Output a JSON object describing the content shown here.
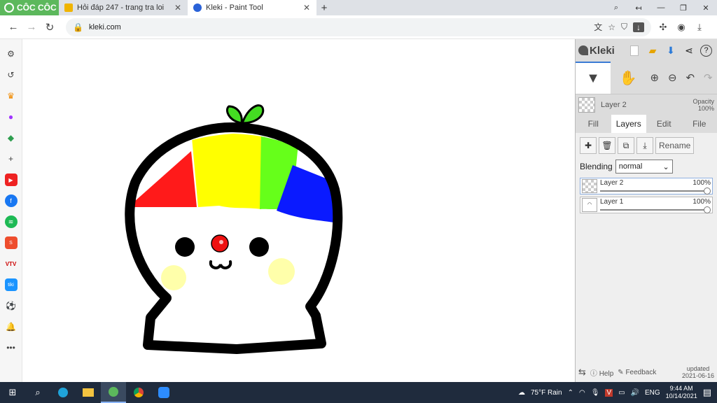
{
  "browser": {
    "brand": "CÔC CÔC",
    "tabs": [
      {
        "title": "Hỏi đáp 247 - trang tra loi",
        "active": false
      },
      {
        "title": "Kleki - Paint Tool",
        "active": true
      }
    ],
    "url": "kleki.com"
  },
  "panel": {
    "logo": "Kleki",
    "current_layer": "Layer 2",
    "opacity_label": "Opacity",
    "opacity_value": "100%",
    "tabs": [
      "Fill",
      "Layers",
      "Edit",
      "File"
    ],
    "active_tab": "Layers",
    "rename_label": "Rename",
    "blending_label": "Blending",
    "blending_value": "normal",
    "layers": [
      {
        "name": "Layer 2",
        "opacity": "100%",
        "selected": true
      },
      {
        "name": "Layer 1",
        "opacity": "100%",
        "selected": false
      }
    ],
    "footer": {
      "help": "Help",
      "feedback": "Feedback",
      "updated_label": "updated",
      "updated_date": "2021-06-16"
    }
  },
  "taskbar": {
    "weather": "75°F  Rain",
    "language": "ENG",
    "time": "9:44 AM",
    "date": "10/14/2021"
  },
  "colors": {
    "hair_red": "#ff1a1a",
    "hair_yellow": "#ffff00",
    "hair_green": "#66ff1a",
    "hair_blue": "#0a1aff",
    "sprout": "#44dd22",
    "cheek": "#ffffaa",
    "nose": "#ee1111"
  }
}
